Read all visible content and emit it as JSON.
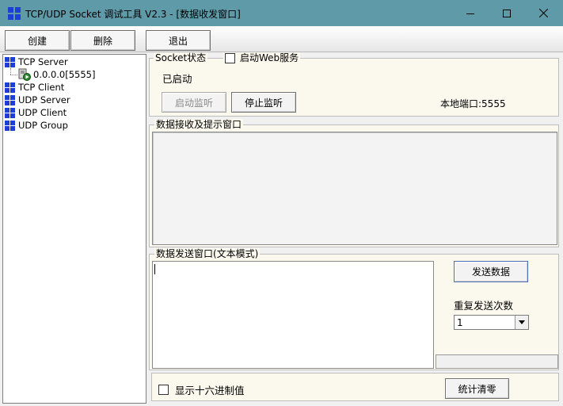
{
  "window": {
    "title": "TCP/UDP Socket 调试工具 V2.3 - [数据收发窗口]",
    "minimize_glyph": "—",
    "maximize_glyph": "☐",
    "close_glyph": "✕"
  },
  "toolbar": {
    "create_label": "创建",
    "delete_label": "删除",
    "exit_label": "退出"
  },
  "tree": {
    "tcp_server": "TCP Server",
    "connection": "0.0.0.0[5555]",
    "tcp_client": "TCP Client",
    "udp_server": "UDP Server",
    "udp_client": "UDP Client",
    "udp_group": "UDP Group"
  },
  "socket_panel": {
    "legend": "Socket状态",
    "web_service_label": "启动Web服务",
    "web_service_checked": false,
    "status_text": "已启动",
    "start_listen_label": "启动监听",
    "stop_listen_label": "停止监听",
    "local_port_label": "本地端口:5555"
  },
  "receive_panel": {
    "legend": "数据接收及提示窗口",
    "content": ""
  },
  "send_panel": {
    "legend": "数据发送窗口(文本模式)",
    "content": "",
    "send_button_label": "发送数据",
    "repeat_label": "重复发送次数",
    "repeat_value": "1"
  },
  "bottom_bar": {
    "hex_label": "显示十六进制值",
    "hex_checked": false,
    "reset_stats_label": "统计清零"
  },
  "colors": {
    "title_bar": "#5e9aa8",
    "panel_bg": "#fbf8ee",
    "icon_blue": "#1e3fd6"
  }
}
